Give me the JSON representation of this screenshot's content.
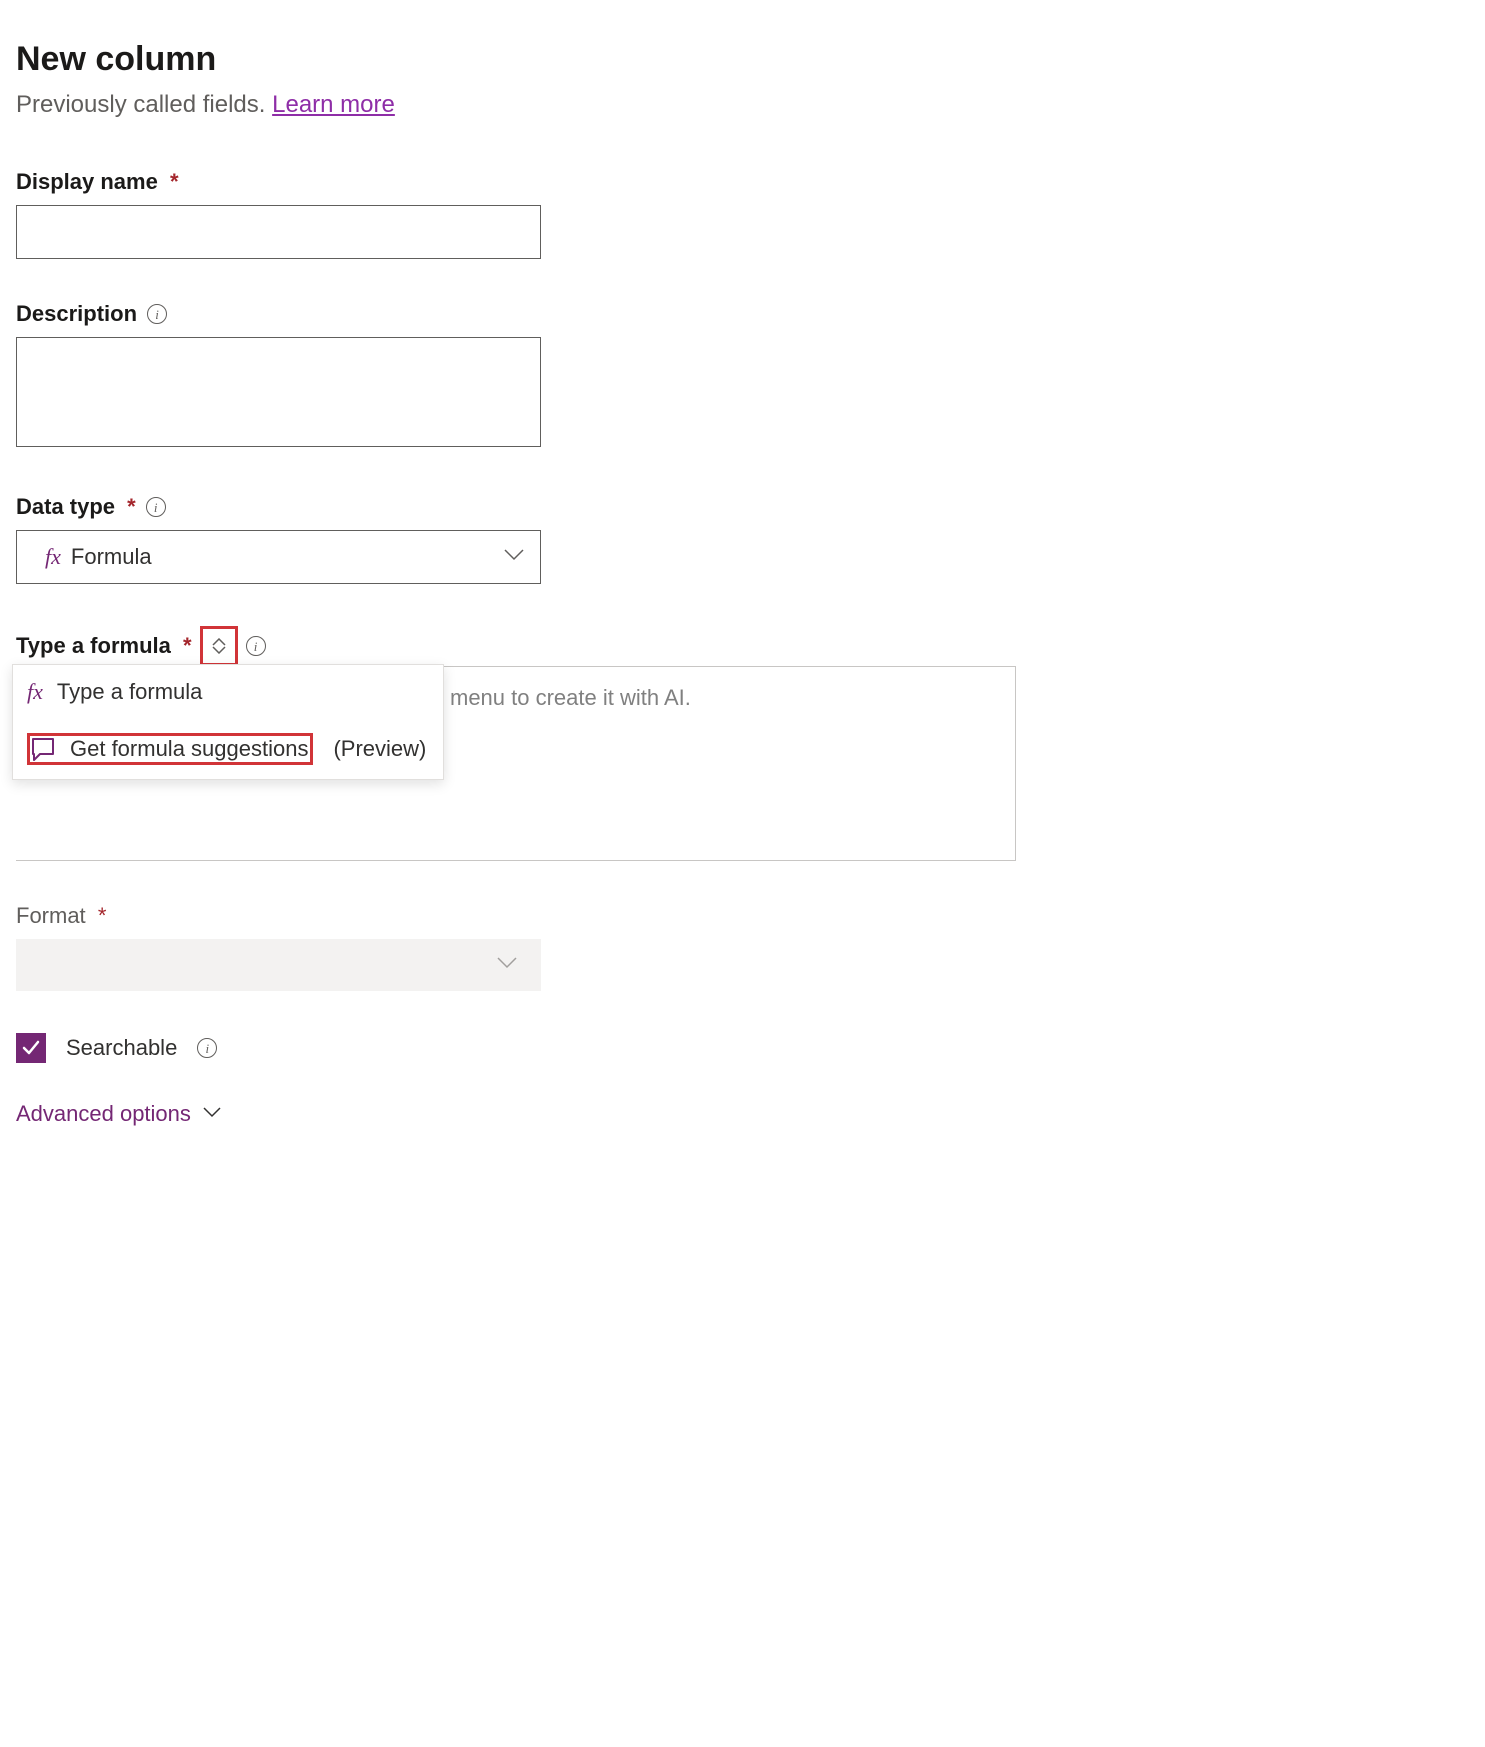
{
  "header": {
    "title": "New column",
    "subtitle_prefix": "Previously called fields. ",
    "learn_more": "Learn more"
  },
  "fields": {
    "display_name": {
      "label": "Display name",
      "required": "*",
      "value": ""
    },
    "description": {
      "label": "Description",
      "value": ""
    },
    "data_type": {
      "label": "Data type",
      "required": "*",
      "selected": "Formula",
      "fx_label": "fx"
    },
    "formula": {
      "label": "Type a formula",
      "required": "*",
      "placeholder_visible": "menu to create it with AI.",
      "dropdown": {
        "option1": {
          "fx_label": "fx",
          "text": "Type a formula"
        },
        "option2": {
          "text": "Get formula suggestions",
          "tag": "(Preview)"
        }
      }
    },
    "format": {
      "label": "Format",
      "required": "*",
      "value": ""
    },
    "searchable": {
      "label": "Searchable",
      "checked": true
    }
  },
  "footer": {
    "advanced_options": "Advanced options"
  }
}
